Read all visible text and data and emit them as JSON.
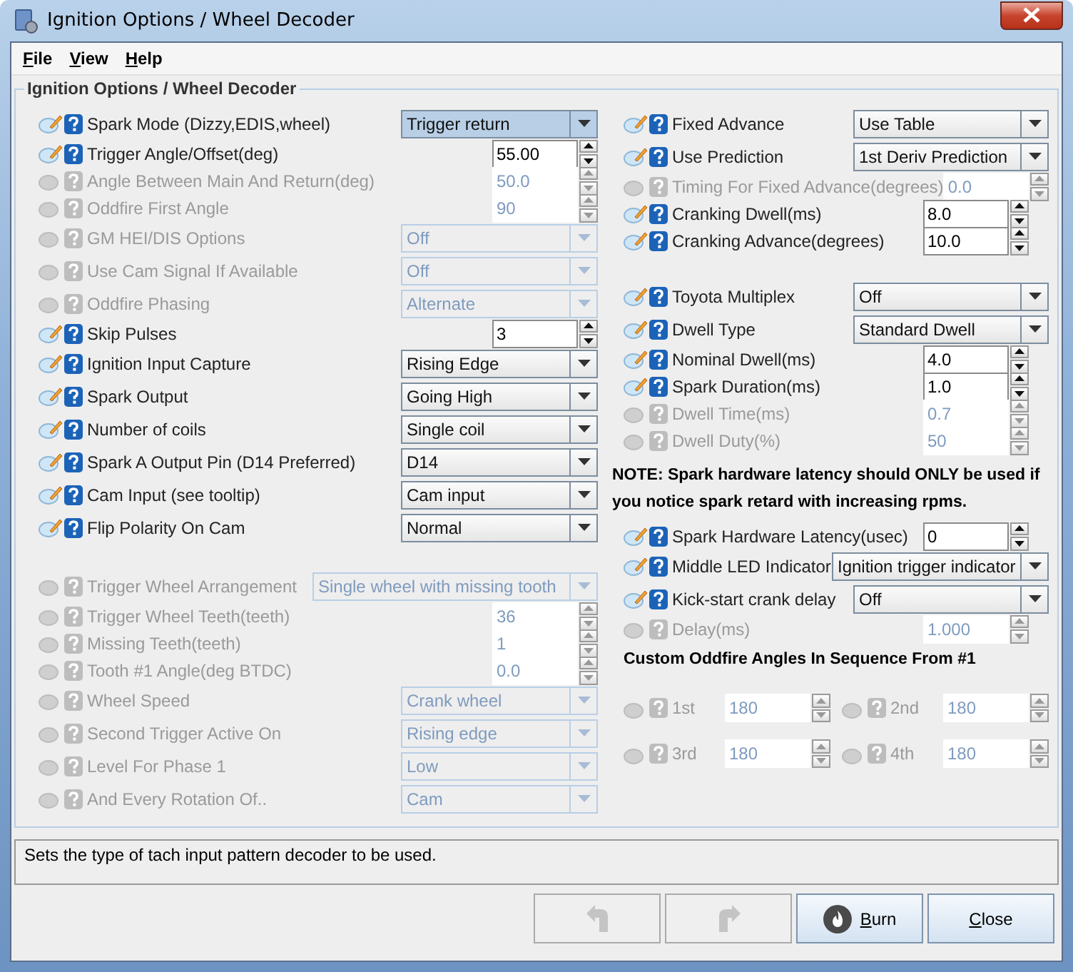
{
  "window": {
    "title": "Ignition Options / Wheel Decoder"
  },
  "menu": [
    {
      "label": "File"
    },
    {
      "label": "View"
    },
    {
      "label": "Help"
    }
  ],
  "panel": {
    "title": "Ignition Options / Wheel Decoder",
    "left": [
      [
        {
          "kind": "select",
          "label": "Spark Mode (Dizzy,EDIS,wheel)",
          "value": "Trigger return",
          "disabled": false,
          "focused": true
        },
        {
          "kind": "spin",
          "label": "Trigger Angle/Offset(deg)",
          "value": "55.00",
          "disabled": false
        },
        {
          "kind": "spin",
          "label": "Angle Between Main And Return(deg)",
          "value": "50.0",
          "disabled": true
        },
        {
          "kind": "spin",
          "label": "Oddfire First Angle",
          "value": "90",
          "disabled": true
        },
        {
          "kind": "select",
          "label": "GM HEI/DIS Options",
          "value": "Off",
          "disabled": true,
          "focused": false
        },
        {
          "kind": "select",
          "label": "Use Cam Signal If Available",
          "value": "Off",
          "disabled": true,
          "focused": false
        },
        {
          "kind": "select",
          "label": "Oddfire Phasing",
          "value": "Alternate",
          "disabled": true,
          "focused": false
        },
        {
          "kind": "spin",
          "label": "Skip Pulses",
          "value": "3",
          "disabled": false
        },
        {
          "kind": "select",
          "label": "Ignition Input Capture",
          "value": "Rising Edge",
          "disabled": false,
          "focused": false
        },
        {
          "kind": "select",
          "label": "Spark Output",
          "value": "Going High",
          "disabled": false,
          "focused": false
        },
        {
          "kind": "select",
          "label": "Number of coils",
          "value": "Single coil",
          "disabled": false,
          "focused": false
        },
        {
          "kind": "select",
          "label": "Spark A Output Pin (D14 Preferred)",
          "value": "D14",
          "disabled": false,
          "focused": false
        },
        {
          "kind": "select",
          "label": "Cam Input (see tooltip)",
          "value": "Cam input",
          "disabled": false,
          "focused": false
        },
        {
          "kind": "select",
          "label": "Flip Polarity On Cam",
          "value": "Normal",
          "disabled": false,
          "focused": false
        }
      ],
      [
        {
          "kind": "wideselect",
          "label": "Trigger Wheel Arrangement",
          "value": "Single wheel with missing tooth",
          "disabled": true,
          "focused": false
        },
        {
          "kind": "spin",
          "label": "Trigger Wheel Teeth(teeth)",
          "value": "36",
          "disabled": true
        },
        {
          "kind": "spin",
          "label": "Missing Teeth(teeth)",
          "value": "1",
          "disabled": true
        },
        {
          "kind": "spin",
          "label": "Tooth #1 Angle(deg BTDC)",
          "value": "0.0",
          "disabled": true
        },
        {
          "kind": "select",
          "label": "Wheel Speed",
          "value": "Crank wheel",
          "disabled": true,
          "focused": false
        },
        {
          "kind": "select",
          "label": "Second Trigger Active On",
          "value": "Rising edge",
          "disabled": true,
          "focused": false
        },
        {
          "kind": "select",
          "label": "Level For Phase 1",
          "value": "Low",
          "disabled": true,
          "focused": false
        },
        {
          "kind": "select",
          "label": "And Every Rotation Of..",
          "value": "Cam",
          "disabled": true,
          "focused": false
        }
      ]
    ],
    "right": [
      {
        "kind": "rows",
        "rows": [
          {
            "kind": "select",
            "label": "Fixed Advance",
            "value": "Use Table",
            "disabled": false,
            "focused": false
          },
          {
            "kind": "select",
            "label": "Use Prediction",
            "value": "1st Deriv Prediction",
            "disabled": false,
            "focused": false
          },
          {
            "kind": "spin",
            "label": "Timing For Fixed Advance(degrees)",
            "value": "0.0",
            "disabled": true
          },
          {
            "kind": "spin",
            "label": "Cranking Dwell(ms)",
            "value": "8.0",
            "disabled": false
          },
          {
            "kind": "spin",
            "label": "Cranking Advance(degrees)",
            "value": "10.0",
            "disabled": false
          }
        ]
      },
      {
        "kind": "rows",
        "rows": [
          {
            "kind": "select",
            "label": "Toyota Multiplex",
            "value": "Off",
            "disabled": false,
            "focused": false
          },
          {
            "kind": "select",
            "label": "Dwell Type",
            "value": "Standard Dwell",
            "disabled": false,
            "focused": false
          },
          {
            "kind": "spin",
            "label": "Nominal Dwell(ms)",
            "value": "4.0",
            "disabled": false
          },
          {
            "kind": "spin",
            "label": "Spark Duration(ms)",
            "value": "1.0",
            "disabled": false
          },
          {
            "kind": "spin",
            "label": "Dwell Time(ms)",
            "value": "0.7",
            "disabled": true
          },
          {
            "kind": "spin",
            "label": "Dwell Duty(%)",
            "value": "50",
            "disabled": true
          }
        ]
      },
      {
        "kind": "note",
        "text": "NOTE: Spark hardware latency should ONLY be used if you notice spark retard with increasing rpms."
      },
      {
        "kind": "rows",
        "rows": [
          {
            "kind": "spin",
            "label": "Spark Hardware Latency(usec)",
            "value": "0",
            "disabled": false
          },
          {
            "kind": "select",
            "label": "Middle LED Indicator",
            "value": "Ignition trigger indicator",
            "disabled": false,
            "focused": false
          },
          {
            "kind": "select",
            "label": "Kick-start crank delay",
            "value": "Off",
            "disabled": false,
            "focused": false
          },
          {
            "kind": "spin",
            "label": "Delay(ms)",
            "value": "1.000",
            "disabled": true
          }
        ]
      },
      {
        "kind": "heading",
        "text": "Custom Oddfire Angles In Sequence From #1"
      },
      {
        "kind": "angles",
        "items": [
          {
            "label": "1st",
            "value": "180",
            "disabled": true
          },
          {
            "label": "2nd",
            "value": "180",
            "disabled": true
          },
          {
            "label": "3rd",
            "value": "180",
            "disabled": true
          },
          {
            "label": "4th",
            "value": "180",
            "disabled": true
          }
        ]
      }
    ]
  },
  "status_bar": {
    "text": "Sets the type of tach input pattern decoder to be used."
  },
  "buttons": [
    {
      "kind": "undo",
      "disabled": true
    },
    {
      "kind": "redo",
      "disabled": true
    },
    {
      "kind": "burn",
      "label": "Burn",
      "disabled": false
    },
    {
      "kind": "close",
      "label": "Close",
      "disabled": false
    }
  ]
}
